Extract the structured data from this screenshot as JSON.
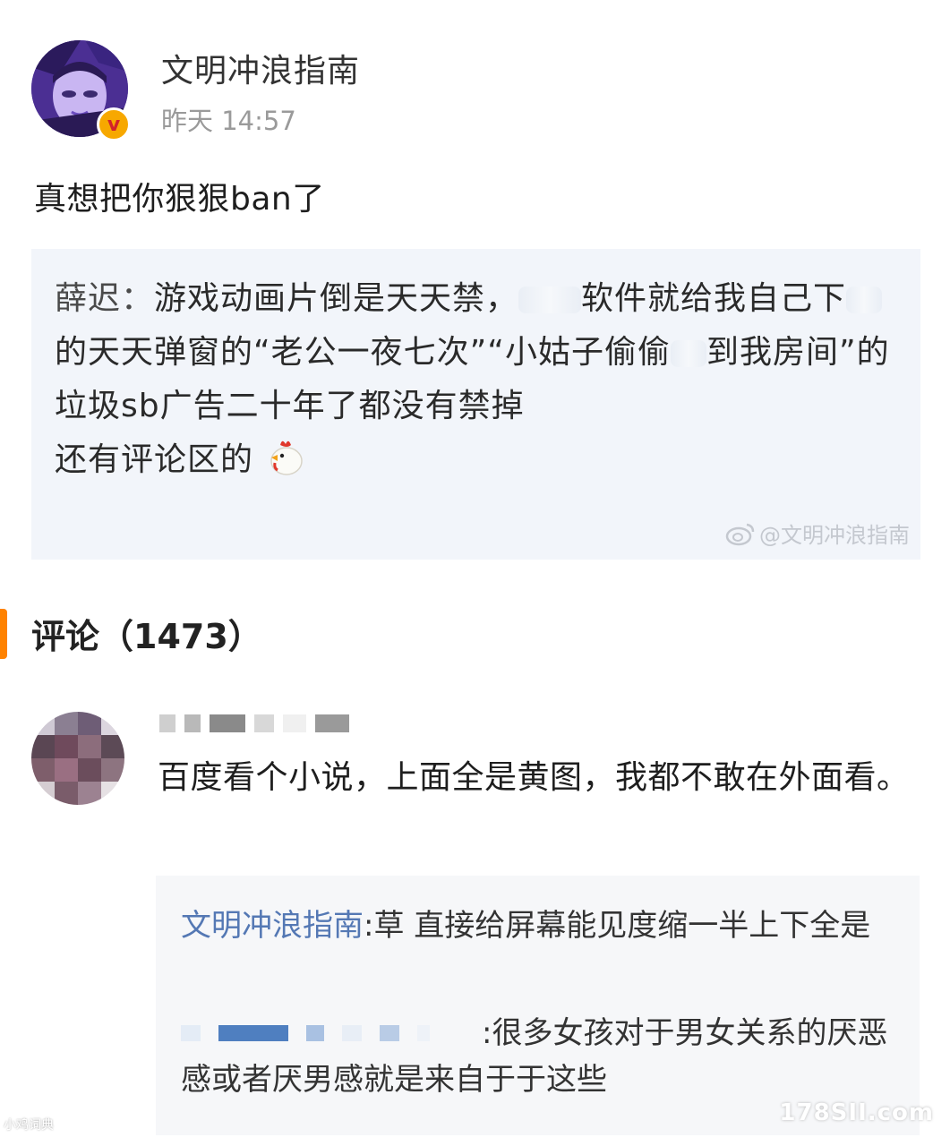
{
  "post": {
    "author": "文明冲浪指南",
    "time": "昨天 14:57",
    "text": "真想把你狠狠ban了",
    "verified_badge": "v"
  },
  "repost": {
    "author": "薛迟：",
    "text_part1": "游戏动画片倒是天天禁，",
    "text_part2": "软件就给我自己下",
    "text_part3": "的天天弹窗的“老公一夜七次”“小姑子偷偷",
    "text_part4": "到我房间”的垃圾sb广告二十年了都没有禁掉",
    "text_line5": "还有评论区的",
    "emoji": "chicken-icon",
    "watermark": "@文明冲浪指南"
  },
  "comments": {
    "title": "评论（1473）",
    "accent_color": "#ff8200",
    "items": [
      {
        "text": "百度看个小说，上面全是黄图，我都不敢在外面看。",
        "replies": [
          {
            "user": "文明冲浪指南",
            "text": ":草 直接给屏幕能见度缩一半上下全是"
          },
          {
            "text": ":很多女孩对于男女关系的厌恶感或者厌男感就是来自于于这些"
          }
        ]
      }
    ]
  },
  "corner_watermarks": {
    "left": "小鸡词典",
    "right": "178SII.com"
  }
}
